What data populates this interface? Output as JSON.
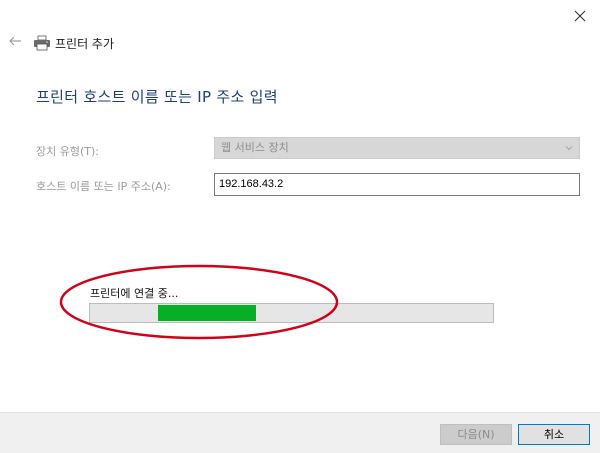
{
  "window": {
    "title": "프린터 추가",
    "close_icon": "close-icon",
    "back_icon": "back-arrow-icon",
    "printer_icon": "printer-icon"
  },
  "page": {
    "heading": "프린터 호스트 이름 또는 IP 주소 입력"
  },
  "form": {
    "device_type_label": "장치 유형(T):",
    "device_type_value": "웹 서비스 장치",
    "host_label": "호스트 이름 또는 IP 주소(A):",
    "host_value": "192.168.43.2"
  },
  "status": {
    "connect_text": "프린터에 연결 중...",
    "progress_color": "#06b025",
    "annotation_color": "#d0021b"
  },
  "footer": {
    "next_label": "다음(N)",
    "cancel_label": "취소"
  }
}
